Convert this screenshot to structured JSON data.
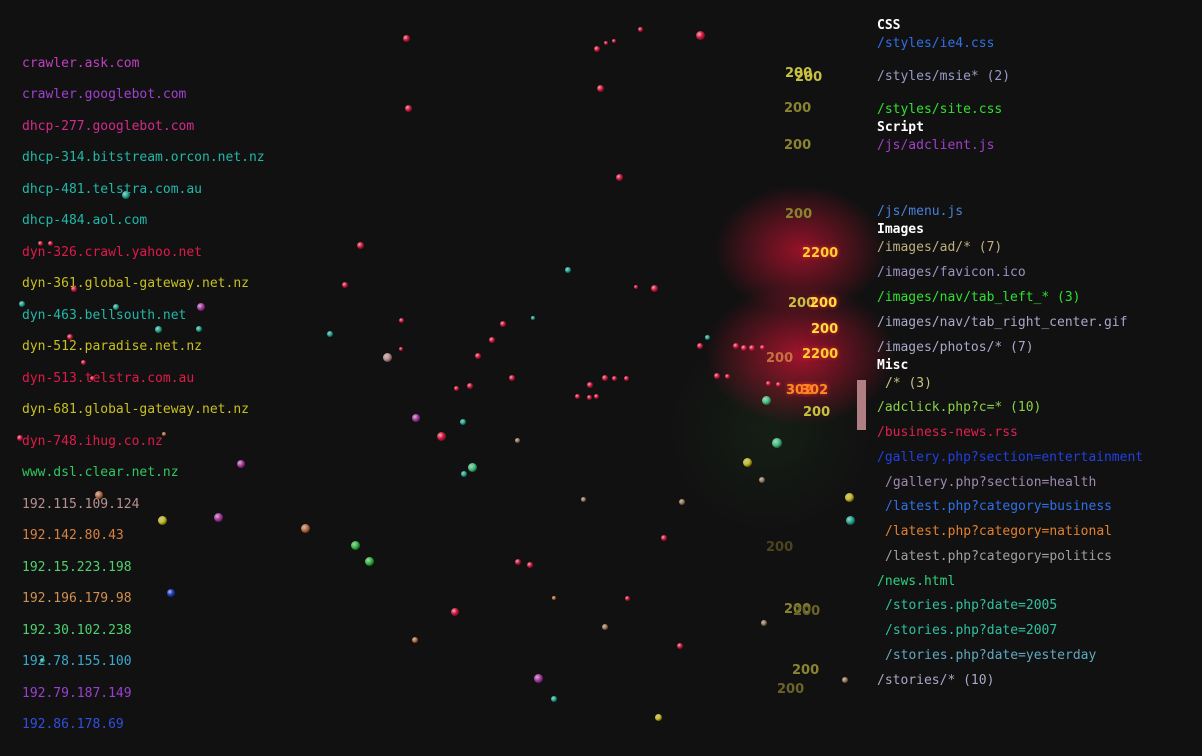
{
  "hosts": [
    {
      "label": "crawler.ask.com",
      "color": "#c040c0"
    },
    {
      "label": "crawler.googlebot.com",
      "color": "#a040d0"
    },
    {
      "label": "dhcp-277.googlebot.com",
      "color": "#d02c8a"
    },
    {
      "label": "dhcp-314.bitstream.orcon.net.nz",
      "color": "#20b8a8"
    },
    {
      "label": "dhcp-481.telstra.com.au",
      "color": "#20b8a8"
    },
    {
      "label": "dhcp-484.aol.com",
      "color": "#20b8a8"
    },
    {
      "label": "dyn-326.crawl.yahoo.net",
      "color": "#e01a4a"
    },
    {
      "label": "dyn-361.global-gateway.net.nz",
      "color": "#c8c020"
    },
    {
      "label": "dyn-463.bellsouth.net",
      "color": "#20b8a8"
    },
    {
      "label": "dyn-512.paradise.net.nz",
      "color": "#c8c020"
    },
    {
      "label": "dyn-513.telstra.com.au",
      "color": "#e01a4a"
    },
    {
      "label": "dyn-681.global-gateway.net.nz",
      "color": "#c8c020"
    },
    {
      "label": "dyn-748.ihug.co.nz",
      "color": "#e01a4a"
    },
    {
      "label": "www.dsl.clear.net.nz",
      "color": "#30c860"
    },
    {
      "label": "192.115.109.124",
      "color": "#b89090"
    },
    {
      "label": "192.142.80.43",
      "color": "#d88040"
    },
    {
      "label": "192.15.223.198",
      "color": "#50d070"
    },
    {
      "label": "192.196.179.98",
      "color": "#d09050"
    },
    {
      "label": "192.30.102.238",
      "color": "#50d070"
    },
    {
      "label": "192.78.155.100",
      "color": "#3aa8d0"
    },
    {
      "label": "192.79.187.149",
      "color": "#9a40d0"
    },
    {
      "label": "192.86.178.69",
      "color": "#3050e0"
    }
  ],
  "categories": [
    {
      "label": "CSS",
      "files": [
        {
          "path": "/styles/ie4.css",
          "color": "#3070e8"
        },
        {
          "path": "/styles/msie* (2)",
          "color": "#9a9ac8"
        },
        {
          "path": "/styles/site.css",
          "color": "#30e030"
        }
      ]
    },
    {
      "label": "Script",
      "files": [
        {
          "path": "/js/adclient.js",
          "color": "#a040c8"
        },
        {
          "path": "/js/menu.js",
          "color": "#4a80d8"
        }
      ]
    },
    {
      "label": "Images",
      "files": [
        {
          "path": "/images/ad/* (7)",
          "color": "#c0b080"
        },
        {
          "path": "/images/favicon.ico",
          "color": "#a090c0"
        },
        {
          "path": "/images/nav/tab_left_* (3)",
          "color": "#30e030"
        },
        {
          "path": "/images/nav/tab_right_center.gif",
          "color": "#a8a8c8"
        },
        {
          "path": "/images/photos/* (7)",
          "color": "#a8a8c8"
        }
      ]
    },
    {
      "label": "Misc",
      "files": [
        {
          "path": "/* (3)",
          "color": "#c8c080",
          "indent": true
        },
        {
          "path": "/adclick.php?c=* (10)",
          "color": "#8ad048"
        },
        {
          "path": "/business-news.rss",
          "color": "#e02050"
        },
        {
          "path": "/gallery.php?section=entertainment",
          "color": "#2040e0"
        },
        {
          "path": "/gallery.php?section=health",
          "color": "#a088b0",
          "indent": true
        },
        {
          "path": "/latest.php?category=business",
          "color": "#3070e8",
          "indent": true
        },
        {
          "path": "/latest.php?category=national",
          "color": "#e08030",
          "indent": true
        },
        {
          "path": "/latest.php?category=politics",
          "color": "#a0a0a0",
          "indent": true
        },
        {
          "path": "/news.html",
          "color": "#30d080"
        },
        {
          "path": "/stories.php?date=2005",
          "color": "#30c0a0",
          "indent": true
        },
        {
          "path": "/stories.php?date=2007",
          "color": "#30c0a0",
          "indent": true
        },
        {
          "path": "/stories.php?date=yesterday",
          "color": "#60a8c0",
          "indent": true
        },
        {
          "path": "/stories/* (10)",
          "color": "#a8a8c8"
        }
      ]
    }
  ],
  "response_codes": [
    {
      "text": "200",
      "color": "#c8c040"
    },
    {
      "text": "200",
      "color": "#c8c040"
    },
    {
      "text": "200",
      "color": "#8a8430"
    },
    {
      "text": "200",
      "color": "#8a8430"
    },
    {
      "text": "200",
      "color": "#8a8430"
    },
    {
      "text": "2200",
      "color": "#ffd030"
    },
    {
      "text": "200",
      "color": "#c8c040"
    },
    {
      "text": "200",
      "color": "#ffe040"
    },
    {
      "text": "200",
      "color": "#ffe040"
    },
    {
      "text": "2200",
      "color": "#ffd030"
    },
    {
      "text": "200",
      "color": "#c87040"
    },
    {
      "text": "302",
      "color": "#ff8a20"
    },
    {
      "text": "302",
      "color": "#ff8a20"
    },
    {
      "text": "200",
      "color": "#c8c040"
    },
    {
      "text": "200",
      "color": "#4a4420"
    },
    {
      "text": "200",
      "color": "#8a8430"
    },
    {
      "text": "200",
      "color": "#6a6428"
    },
    {
      "text": "200",
      "color": "#8a8430"
    },
    {
      "text": "200",
      "color": "#6a6428"
    }
  ]
}
